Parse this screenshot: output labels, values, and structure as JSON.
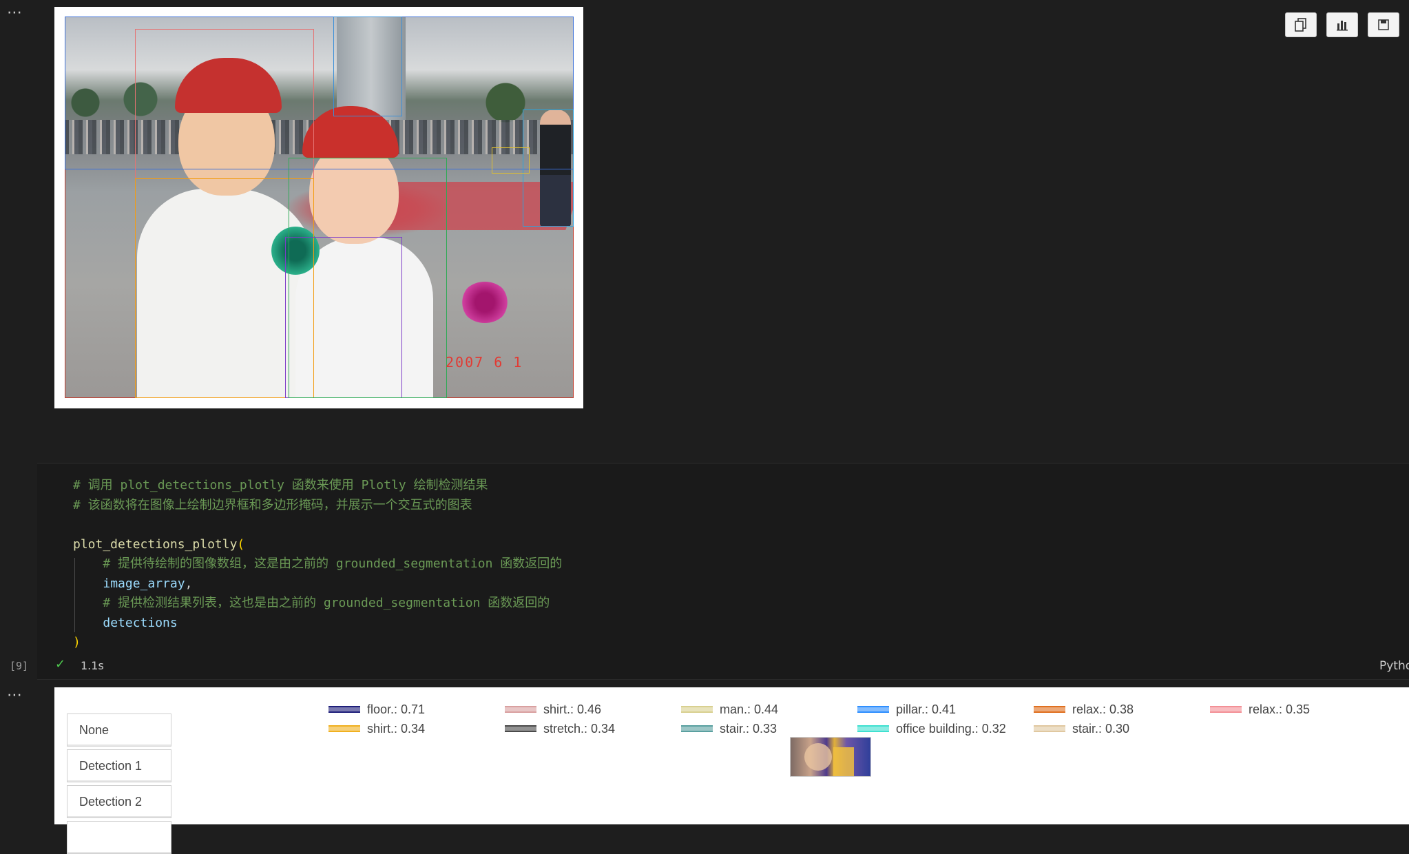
{
  "notebook": {
    "more_actions_glyph": "⋯"
  },
  "image_output": {
    "timestamp_overlay": "2007  6  1"
  },
  "toolbar": {
    "icons": [
      "copy-icon",
      "chart-icon",
      "save-icon"
    ]
  },
  "code_cell": {
    "lines": {
      "comment1": "# 调用 plot_detections_plotly 函数来使用 Plotly 绘制检测结果",
      "comment2": "# 该函数将在图像上绘制边界框和多边形掩码，并展示一个交互式的图表",
      "call_fn": "plot_detections_plotly",
      "open_paren": "(",
      "comment3": "# 提供待绘制的图像数组，这是由之前的 grounded_segmentation 函数返回的",
      "arg1": "image_array",
      "comma": ",",
      "comment4": "# 提供检测结果列表，这也是由之前的 grounded_segmentation 函数返回的",
      "arg2": "detections",
      "close_paren": ")"
    },
    "execution_count": "[9]",
    "status_check": "✓",
    "duration": "1.1s",
    "language": "Python"
  },
  "plot_output": {
    "buttons": [
      "None",
      "Detection 1",
      "Detection 2"
    ],
    "legend": [
      {
        "label": "floor.: 0.71",
        "color": "#1f1f7a"
      },
      {
        "label": "shirt.: 0.46",
        "color": "#d9a0a0"
      },
      {
        "label": "man.: 0.44",
        "color": "#d8d090"
      },
      {
        "label": "pillar.: 0.41",
        "color": "#2f8fff"
      },
      {
        "label": "relax.: 0.38",
        "color": "#e07020"
      },
      {
        "label": "relax.: 0.35",
        "color": "#f39096"
      },
      {
        "label": "shirt.: 0.34",
        "color": "#f0b020"
      },
      {
        "label": "stretch.: 0.34",
        "color": "#4a4a4a"
      },
      {
        "label": "stair.: 0.33",
        "color": "#5aa0a0"
      },
      {
        "label": "office building.: 0.32",
        "color": "#40e0d0"
      },
      {
        "label": "stair.: 0.30",
        "color": "#e0c8a0"
      }
    ]
  }
}
